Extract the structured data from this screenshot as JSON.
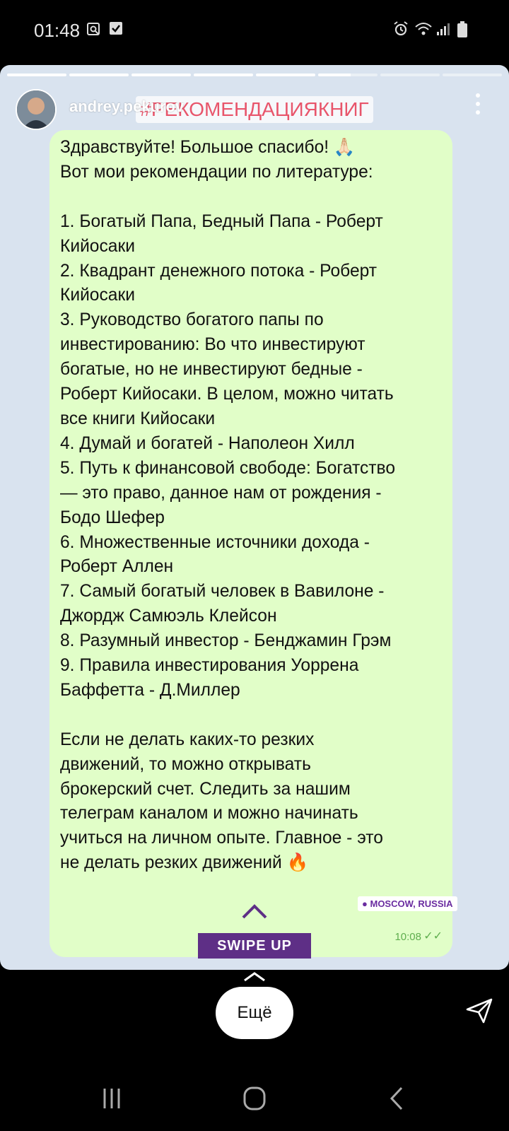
{
  "status_bar": {
    "time": "01:48",
    "icons": [
      "screenshot-icon",
      "check-icon",
      "alarm-icon",
      "wifi-icon",
      "signal-icon",
      "battery-icon"
    ]
  },
  "story": {
    "progress_segments": 8,
    "active_segment": 5,
    "active_segment_progress": 0.55,
    "username": "andrey.pekurov",
    "hashtag": "#РЕКОМЕНДАЦИЯКНИГ",
    "message": {
      "text": "Здравствуйте! Большое спасибо! 🙏🏻\nВот мои рекомендации по литературе:\n\n1. Богатый Папа, Бедный Папа - Роберт\nКийосаки\n2. Квадрант денежного потока - Роберт\nКийосаки\n3. Руководство богатого папы по\nинвестированию: Во что инвестируют\nбогатые, но не инвестируют бедные -\nРоберт Кийосаки. В целом, можно читать\nвсе книги Кийосаки\n4. Думай и богатей - Наполеон Хилл\n5. Путь к финансовой свободе: Богатство\n— это право, данное нам от рождения -\nБодо Шефер\n6. Множественные источники дохода -\nРоберт Аллен\n7. Самый богатый человек в Вавилоне -\nДжордж Самюэль Клейсон\n8. Разумный инвестор - Бенджамин Грэм\n9. Правила инвестирования Уоррена\nБаффетта - Д.Миллер\n\nЕсли не делать каких-то резких\nдвижений, то можно открывать\nброкерский счет. Следить за нашим\nтелеграм каналом и можно начинать\nучиться на личном опыте. Главное - это\nне делать резких движений 🔥",
      "time": "10:08",
      "status": "read"
    },
    "location_sticker": "MOSCOW, RUSSIA",
    "swipe_up_label": "SWIPE UP"
  },
  "bottom": {
    "more_label": "Ещё"
  },
  "colors": {
    "bubble": "#e1fec8",
    "story_bg": "#d9e3ef",
    "swipe_up_bg": "#5e2f86",
    "hashtag_text": "#e8556b",
    "message_time": "#5fae4e"
  }
}
